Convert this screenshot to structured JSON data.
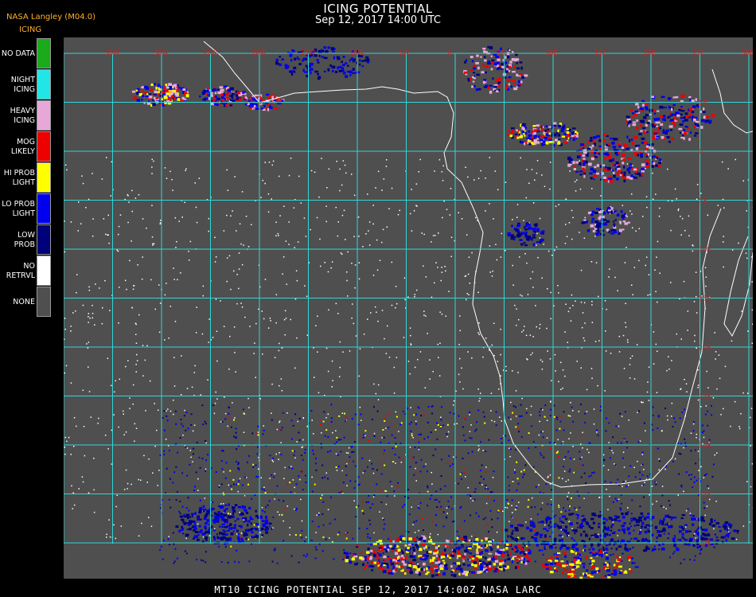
{
  "header": {
    "title": "ICING POTENTIAL",
    "subtitle": "Sep 12, 2017 14:00 UTC",
    "org": "NASA Langley (M04.0)",
    "product": "ICING"
  },
  "legend": [
    {
      "label": "NO DATA",
      "color": "#1aaa1a"
    },
    {
      "label": "NIGHT\nICING",
      "color": "#22e6e6"
    },
    {
      "label": "HEAVY\nICING",
      "color": "#e7a8d8"
    },
    {
      "label": "MOG\nLIKELY",
      "color": "#ee0000"
    },
    {
      "label": "HI PROB\nLIGHT",
      "color": "#ffff00"
    },
    {
      "label": "LO PROB\nLIGHT",
      "color": "#0000ee"
    },
    {
      "label": "LOW\nPROB",
      "color": "#00007a"
    },
    {
      "label": "NO\nRETRVL",
      "color": "#ffffff"
    },
    {
      "label": "NONE",
      "color": "#4f4f4f"
    }
  ],
  "grid": {
    "color": "#30d6d6",
    "label_color": "#cc2222",
    "lon_labels": [
      "35W",
      "30W",
      "25W",
      "20W",
      "15W",
      "10W",
      "5W",
      "0",
      "5E",
      "10E",
      "15E",
      "20E",
      "25E",
      "30E",
      "35E"
    ],
    "lat_labels": [
      "10N",
      "5N",
      "0",
      "5S",
      "10S",
      "15S",
      "20S",
      "25S",
      "30S",
      "35S",
      "40S"
    ]
  },
  "footer": {
    "text": "MT10  ICING POTENTIAL   SEP 12, 2017 14:00Z   NASA LARC"
  }
}
